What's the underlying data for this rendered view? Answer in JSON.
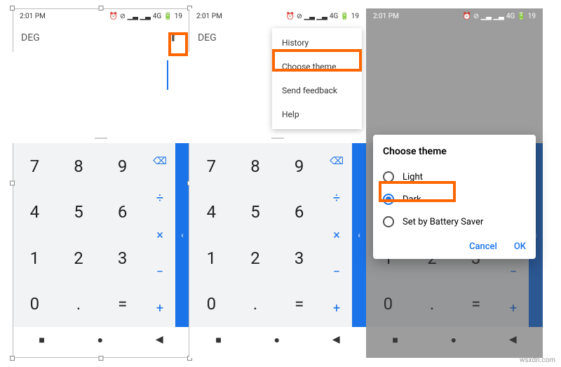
{
  "status": {
    "time": "2:01 PM",
    "net": "4G",
    "batt": "19"
  },
  "deg": "DEG",
  "menu": {
    "history": "History",
    "choose": "Choose theme",
    "feedback": "Send feedback",
    "help": "Help"
  },
  "keys": {
    "r1": [
      "7",
      "8",
      "9"
    ],
    "r2": [
      "4",
      "5",
      "6"
    ],
    "r3": [
      "1",
      "2",
      "3"
    ],
    "r4": [
      "0",
      ".",
      "="
    ]
  },
  "ops": {
    "bksp": "⌫",
    "div": "÷",
    "mul": "×",
    "sub": "−",
    "add": "+"
  },
  "adv": "‹",
  "dialog": {
    "title": "Choose theme",
    "light": "Light",
    "dark": "Dark",
    "battery": "Set by Battery Saver",
    "cancel": "Cancel",
    "ok": "OK"
  },
  "nav": {
    "recent": "■",
    "home": "●",
    "back": "◀"
  },
  "watermark": "wsxdn.com"
}
